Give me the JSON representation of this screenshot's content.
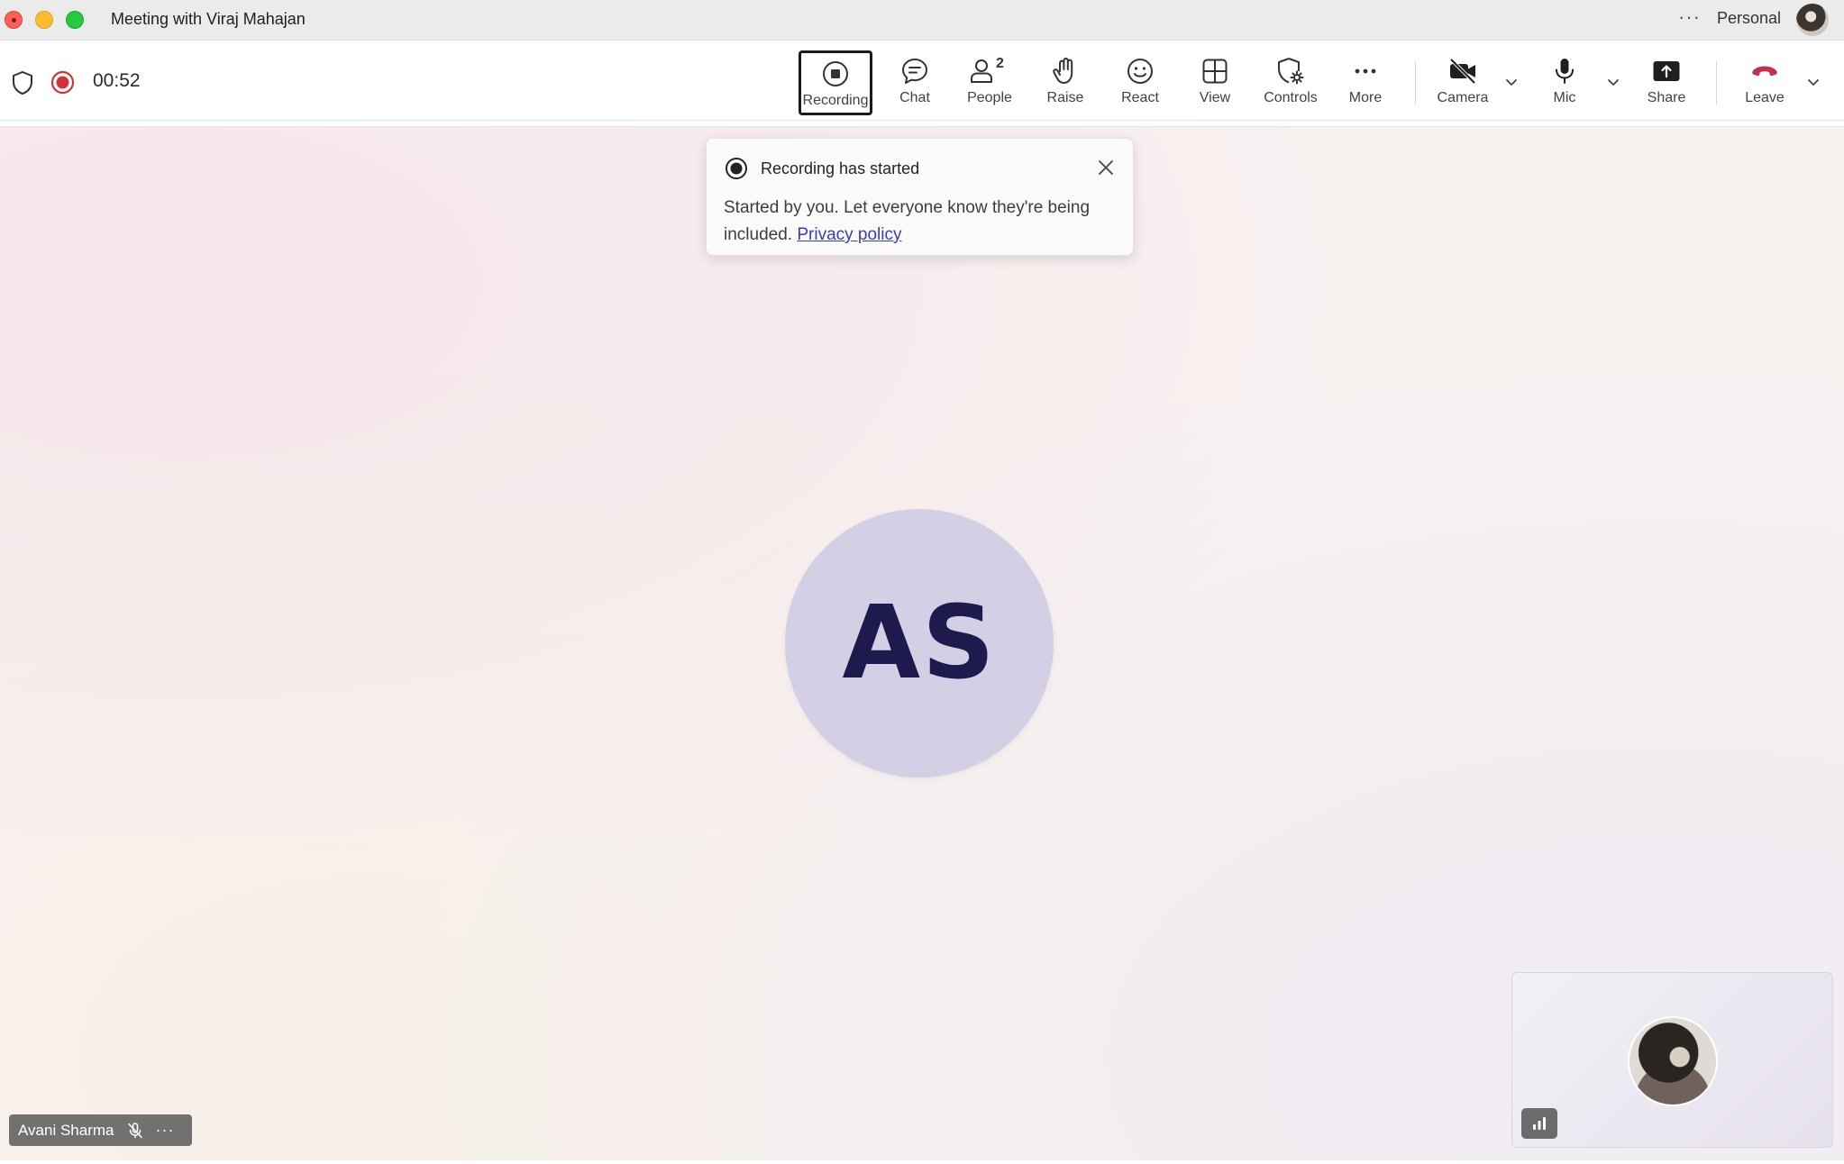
{
  "window": {
    "title": "Meeting with Viraj Mahajan",
    "account_label": "Personal",
    "more_label": "···"
  },
  "toolbar": {
    "timer": "00:52",
    "buttons": {
      "recording": "Recording",
      "chat": "Chat",
      "people": "People",
      "people_count": "2",
      "raise": "Raise",
      "react": "React",
      "view": "View",
      "controls": "Controls",
      "more": "More",
      "camera": "Camera",
      "mic": "Mic",
      "share": "Share",
      "leave": "Leave"
    }
  },
  "toast": {
    "title": "Recording has started",
    "body": "Started by you. Let everyone know they're being included.",
    "link": "Privacy policy"
  },
  "stage": {
    "participant_initials": "AS",
    "participant_name": "Avani Sharma",
    "name_more": "···"
  },
  "colors": {
    "accent_leave": "#c4314b",
    "record_red": "#d13438",
    "avatar_bg": "#d3d0e6",
    "avatar_text": "#1e1a4d",
    "link": "#3a3fa8"
  },
  "icons": {
    "shield": "shield-icon",
    "record_status": "record-dot-icon",
    "recording": "stop-record-icon",
    "chat": "chat-icon",
    "people": "people-icon",
    "raise": "hand-icon",
    "react": "smiley-icon",
    "view": "grid-icon",
    "controls": "shield-gear-icon",
    "more": "ellipsis-icon",
    "camera": "camera-off-icon",
    "mic": "mic-icon",
    "share": "share-tray-icon",
    "leave": "phone-hangup-icon",
    "close": "close-icon",
    "mic_off": "mic-off-icon",
    "signal": "signal-bars-icon"
  }
}
